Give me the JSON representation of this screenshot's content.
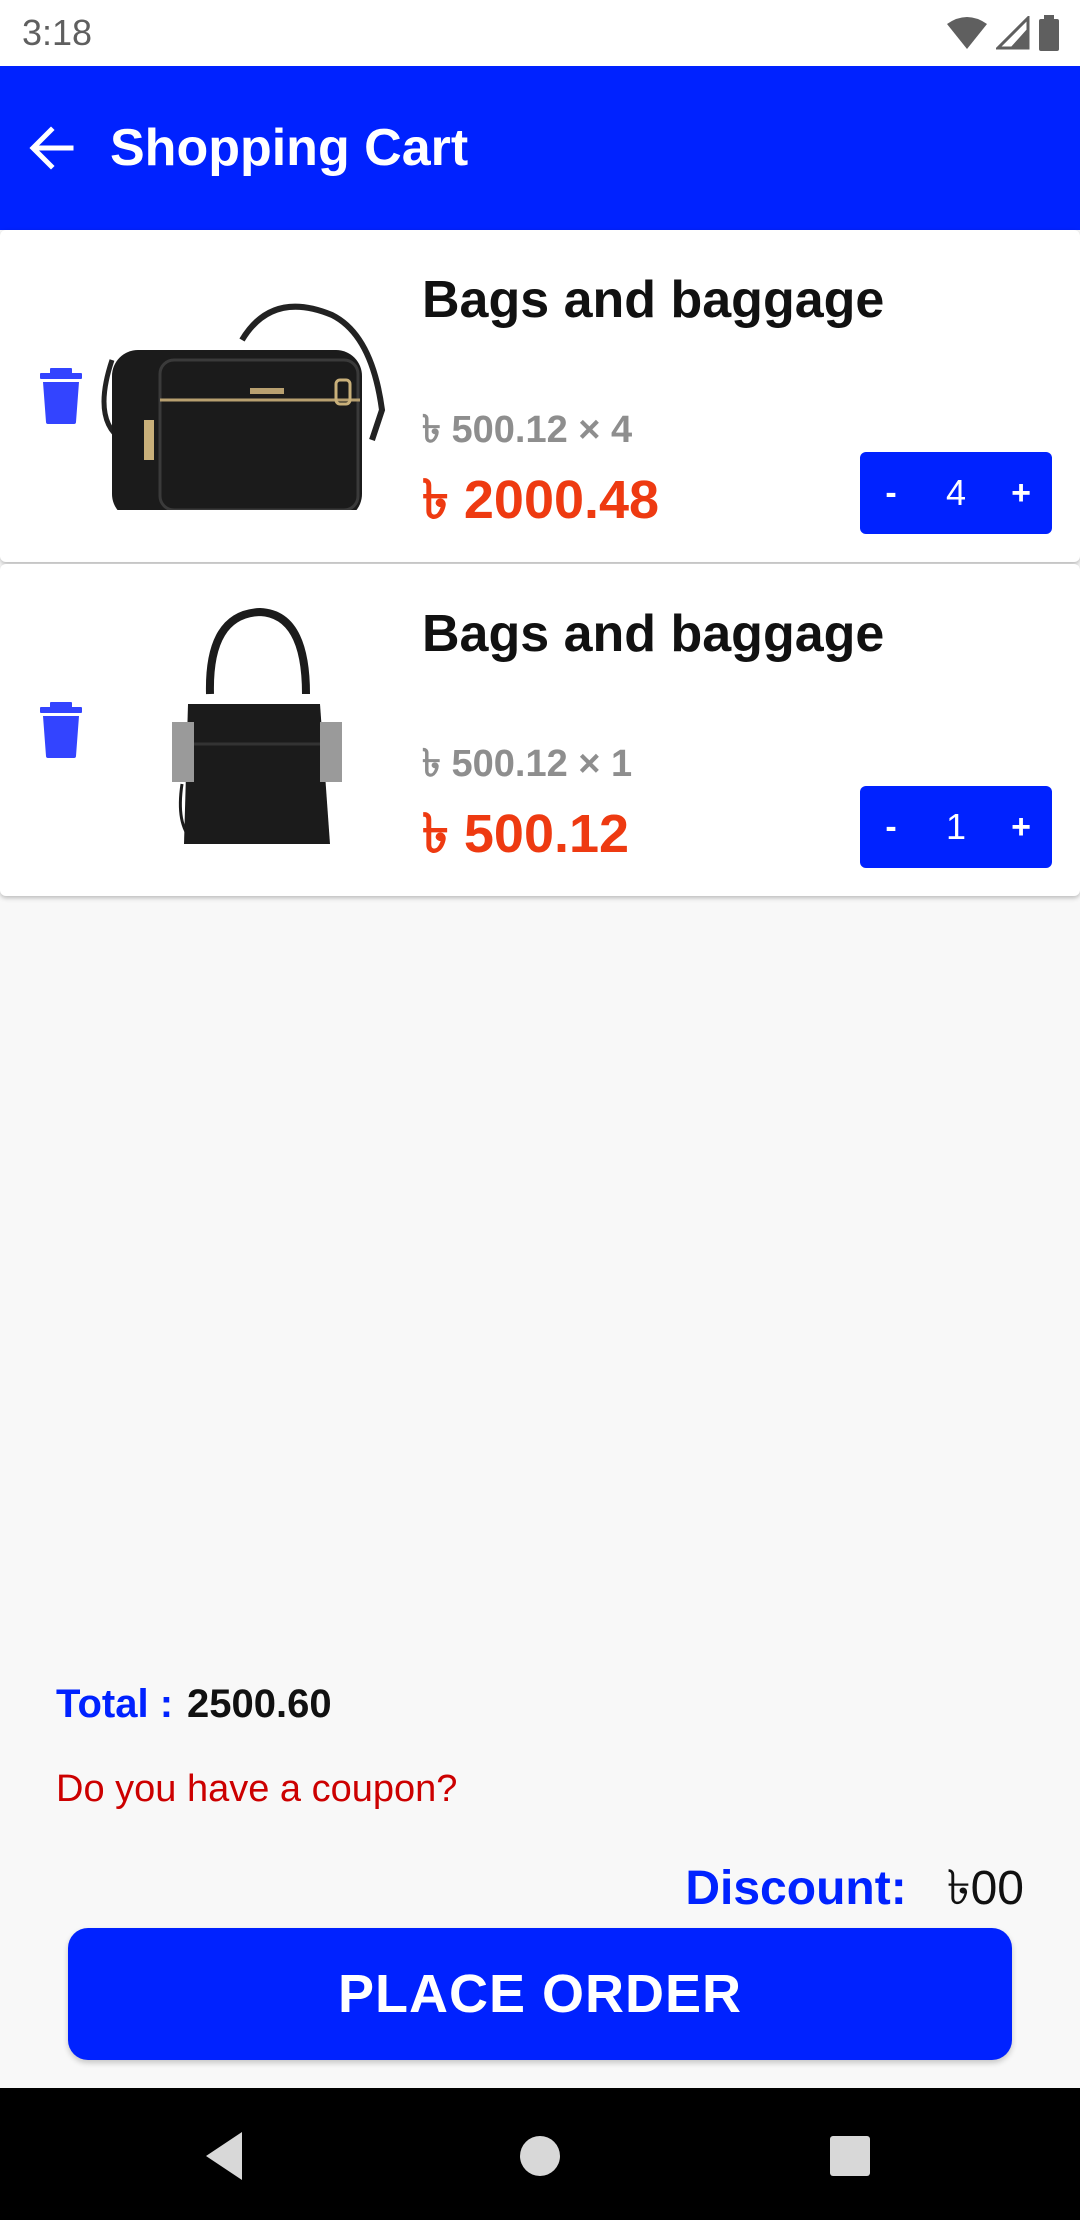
{
  "status_bar": {
    "time": "3:18"
  },
  "app_bar": {
    "title": "Shopping Cart"
  },
  "cart_items": [
    {
      "name": "Bags and baggage",
      "unit_line": "৳ 500.12 × 4",
      "line_total": "৳ 2000.48",
      "quantity": "4",
      "minus_label": "-",
      "plus_label": "+"
    },
    {
      "name": "Bags and baggage",
      "unit_line": "৳ 500.12 × 1",
      "line_total": "৳ 500.12",
      "quantity": "1",
      "minus_label": "-",
      "plus_label": "+"
    }
  ],
  "summary": {
    "total_label": "Total :",
    "total_value": "2500.60",
    "coupon_text": "Do you have a coupon?",
    "discount_label": "Discount:",
    "discount_value": "৳00"
  },
  "place_order_label": "PLACE ORDER",
  "colors": {
    "primary": "#0022ff",
    "price": "#ee3a11",
    "coupon": "#cc0000"
  }
}
